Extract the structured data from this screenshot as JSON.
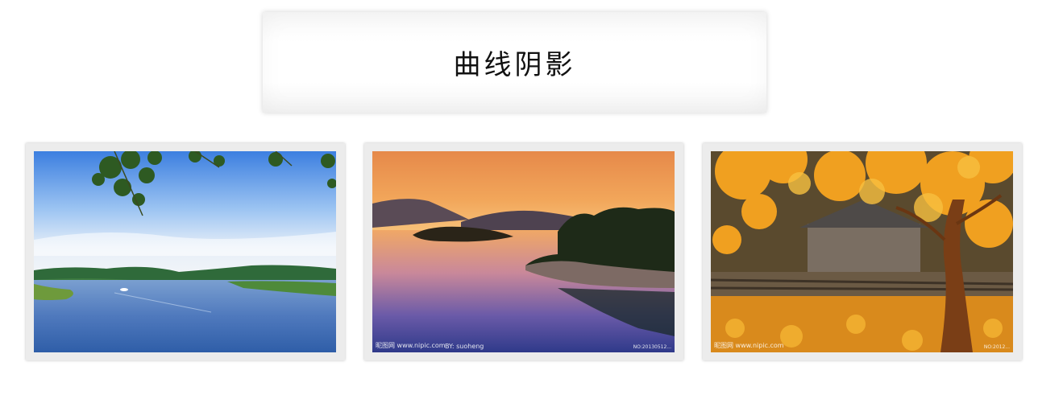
{
  "header": {
    "title": "曲线阴影"
  },
  "gallery": {
    "cards": [
      {
        "image": "lake-with-blue-sky-and-tree-branches"
      },
      {
        "image": "sunset-lake-with-rocky-island"
      },
      {
        "image": "autumn-maple-tree-and-wooden-cabin"
      }
    ]
  },
  "watermarks": {
    "photo2_left": "昵图网 www.nipic.com",
    "photo2_by": "BY: suoheng",
    "photo2_id": "NO:20130512...",
    "photo3_left": "昵图网 www.nipic.com",
    "photo3_id": "NO:2012..."
  },
  "colors": {
    "card_background": "#ececec",
    "title_text": "#111111"
  }
}
